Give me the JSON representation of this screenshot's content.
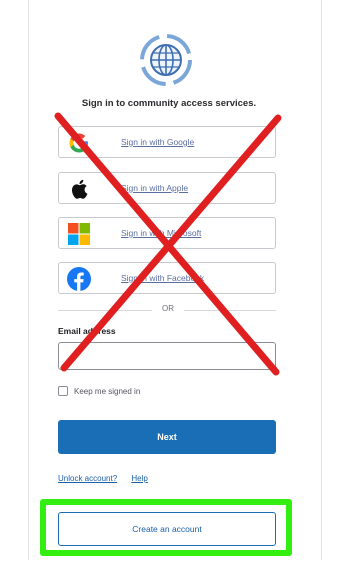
{
  "heading": "Sign in to community access services.",
  "providers": [
    {
      "label": "Sign in with Google",
      "icon": "google-icon"
    },
    {
      "label": "Sign in with Apple",
      "icon": "apple-icon"
    },
    {
      "label": "Sign in with Microsoft",
      "icon": "microsoft-icon"
    },
    {
      "label": "Sign in with Facebook",
      "icon": "facebook-icon"
    }
  ],
  "divider_text": "OR",
  "email": {
    "label": "Email address",
    "value": "",
    "placeholder": ""
  },
  "keep_signed_in": {
    "label": "Keep me signed in",
    "checked": false
  },
  "next_label": "Next",
  "links": {
    "unlock": "Unlock account?",
    "help": "Help"
  },
  "create_account_label": "Create an account",
  "colors": {
    "primary": "#1a6eb5",
    "annotation_cross": "#e02020",
    "annotation_highlight": "#33ee11"
  },
  "annotations": {
    "cross_mark": "red-x-mark",
    "highlight_box": "green-highlight-box"
  }
}
